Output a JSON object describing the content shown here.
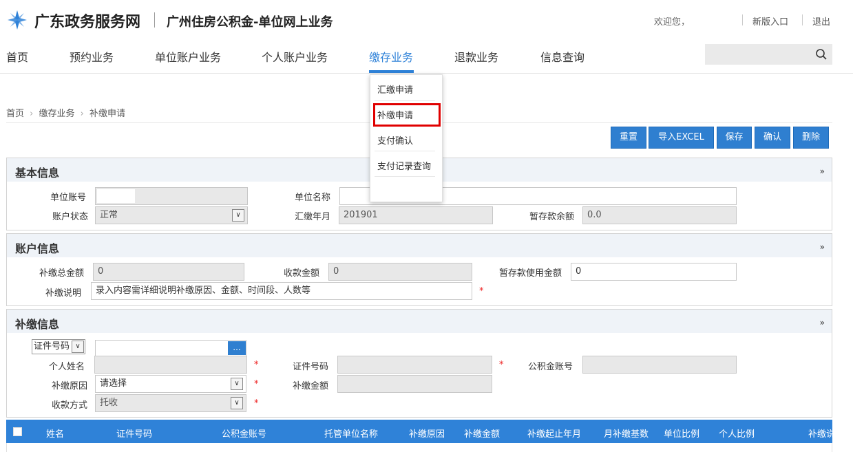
{
  "header": {
    "site_name": "广东政务服务网",
    "system_title": "广州住房公积金-单位网上业务",
    "welcome": "欢迎您，",
    "new_entry": "新版入口",
    "logout": "退出"
  },
  "nav": {
    "items": [
      "首页",
      "预约业务",
      "单位账户业务",
      "个人账户业务",
      "缴存业务",
      "退款业务",
      "信息查询"
    ],
    "active_index": 4,
    "search_placeholder": ""
  },
  "dropdown": {
    "items": [
      "汇缴申请",
      "补缴申请",
      "支付确认",
      "支付记录查询"
    ],
    "highlighted_index": 1
  },
  "breadcrumb": [
    "首页",
    "缴存业务",
    "补缴申请"
  ],
  "toolbar": {
    "reset": "重置",
    "import_excel": "导入EXCEL",
    "save": "保存",
    "confirm": "确认",
    "delete": "删除"
  },
  "basic_info": {
    "title": "基本信息",
    "unit_account_label": "单位账号",
    "unit_account_value": "",
    "unit_name_label": "单位名称",
    "unit_name_value": "",
    "account_status_label": "账户状态",
    "account_status_value": "正常",
    "remit_month_label": "汇缴年月",
    "remit_month_value": "201901",
    "temp_balance_label": "暂存款余额",
    "temp_balance_value": "0.0"
  },
  "account_info": {
    "title": "账户信息",
    "total_label": "补缴总金额",
    "total_value": "0",
    "received_label": "收款金额",
    "received_value": "0",
    "temp_used_label": "暂存款使用金额",
    "temp_used_value": "0",
    "note_label": "补缴说明",
    "note_value": "录入内容需详细说明补缴原因、金额、时间段、人数等",
    "required_mark": "*"
  },
  "supp_info": {
    "title": "补缴信息",
    "id_type_value": "证件号码",
    "lookup_button": "...",
    "name_label": "个人姓名",
    "id_no_label": "证件号码",
    "fund_account_label": "公积金账号",
    "reason_label": "补缴原因",
    "reason_value": "请选择",
    "amount_label": "补缴金额",
    "payment_method_label": "收款方式",
    "payment_method_value": "托收",
    "required_mark": "*"
  },
  "table": {
    "columns": [
      "姓名",
      "证件号码",
      "公积金账号",
      "托管单位名称",
      "补缴原因",
      "补缴金额",
      "补缴起止年月",
      "月补缴基数",
      "单位比例",
      "个人比例",
      "补缴说"
    ]
  },
  "colors": {
    "accent": "#2f82d8",
    "button": "#2f7fd0",
    "highlight": "#e00000",
    "required": "#e22222"
  }
}
